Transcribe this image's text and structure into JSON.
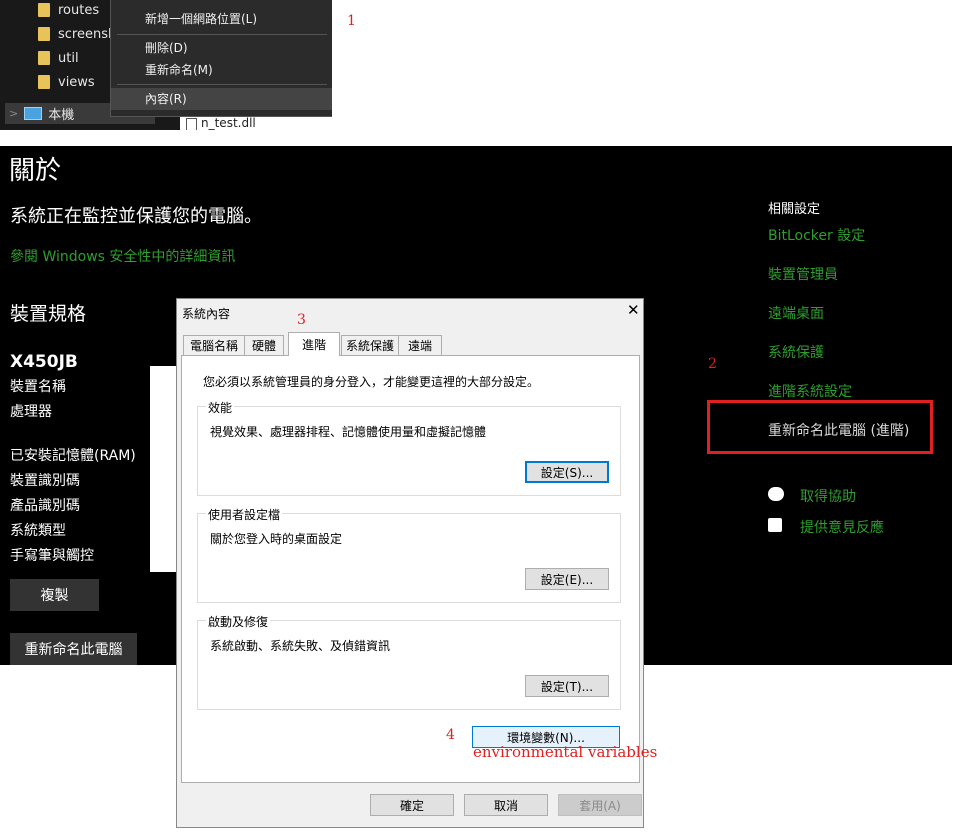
{
  "explorer": {
    "folders": [
      "routes",
      "screensho",
      "util",
      "views"
    ],
    "this_pc_label": "本機",
    "file_label": "n_test.dll"
  },
  "context_menu": {
    "items": [
      "新增一個網路位置(L)",
      "刪除(D)",
      "重新命名(M)",
      "內容(R)"
    ]
  },
  "annotations": {
    "step1": "1",
    "step2": "2",
    "step3": "3",
    "step4": "4",
    "env_note": "environmental variables"
  },
  "settings": {
    "title": "關於",
    "protection_text": "系統正在監控並保護您的電腦。",
    "security_link": "參閱 Windows 安全性中的詳細資訊",
    "device_specs_heading": "裝置規格",
    "device_model": "X450JB",
    "spec_labels": [
      "裝置名稱",
      "處理器",
      "已安裝記憶體(RAM)",
      "裝置識別碼",
      "產品識別碼",
      "系統類型",
      "手寫筆與觸控"
    ],
    "copy_button": "複製",
    "rename_button": "重新命名此電腦",
    "related_settings_heading": "相關設定",
    "related_links": [
      "BitLocker 設定",
      "裝置管理員",
      "遠端桌面",
      "系統保護",
      "進階系統設定"
    ],
    "rename_advanced_link": "重新命名此電腦 (進階)",
    "help_link": "取得協助",
    "feedback_link": "提供意見反應"
  },
  "dialog": {
    "title": "系統內容",
    "close_glyph": "✕",
    "tabs": [
      "電腦名稱",
      "硬體",
      "進階",
      "系統保護",
      "遠端"
    ],
    "active_tab": "進階",
    "admin_note": "您必須以系統管理員的身分登入，才能變更這裡的大部分設定。",
    "performance": {
      "title": "效能",
      "description": "視覺效果、處理器排程、記憶體使用量和虛擬記憶體",
      "button": "設定(S)..."
    },
    "user_profiles": {
      "title": "使用者設定檔",
      "description": "關於您登入時的桌面設定",
      "button": "設定(E)..."
    },
    "startup_recovery": {
      "title": "啟動及修復",
      "description": "系統啟動、系統失敗、及偵錯資訊",
      "button": "設定(T)..."
    },
    "env_button": "環境變數(N)...",
    "ok_button": "確定",
    "cancel_button": "取消",
    "apply_button": "套用(A)"
  }
}
